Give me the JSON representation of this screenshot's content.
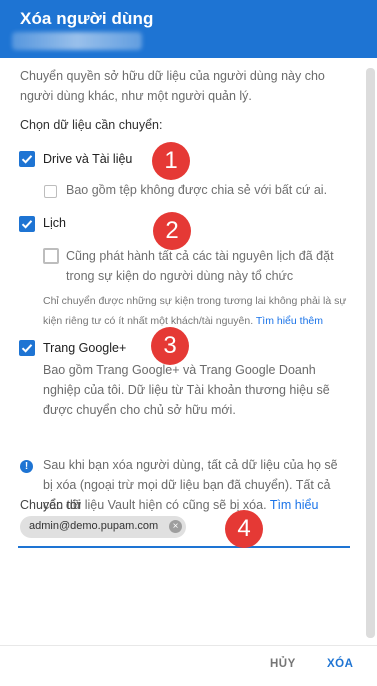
{
  "dialog": {
    "title": "Xóa người dùng",
    "intro": "Chuyển quyền sở hữu dữ liệu của người dùng này cho người dùng khác, như một người quản lý.",
    "section_title": "Chọn dữ liệu cần chuyển:",
    "items": [
      {
        "label": "Drive và Tài liệu",
        "checked": true
      },
      {
        "label": "Lịch",
        "checked": true
      },
      {
        "label": "Trang Google+",
        "checked": true
      }
    ],
    "drive_sub": "Bao gồm tệp không được chia sẻ với bất cứ ai.",
    "calendar_sub": "Cũng phát hành tất cả các tài nguyên lịch đã đặt trong sự kiện do người dùng này tổ chức",
    "calendar_note": "Chỉ chuyển được những sự kiện trong tương lai không phải là sự kiện riêng tư có ít nhất một khách/tài nguyên.",
    "calendar_note_link": "Tìm hiểu thêm",
    "gplus_desc": "Bao gồm Trang Google+ và Trang Google Doanh nghiệp của tôi. Dữ liệu từ Tài khoản thương hiệu sẽ được chuyển cho chủ sở hữu mới.",
    "info_text": "Sau khi bạn xóa người dùng, tất cả dữ liệu của họ sẽ bị xóa (ngoại trừ mọi dữ liệu bạn đã chuyển). Tất cả các dữ liệu Vault hiện có cũng sẽ bị xóa.",
    "info_link": "Tìm hiểu thêm",
    "transfer_label": "Chuyển tới",
    "transfer_chip": "admin@demo.pupam.com",
    "cancel_label": "HỦY",
    "delete_label": "XÓA"
  },
  "annotations": [
    "1",
    "2",
    "3",
    "4"
  ],
  "colors": {
    "primary": "#1e74d3",
    "annotation": "#e53935"
  }
}
